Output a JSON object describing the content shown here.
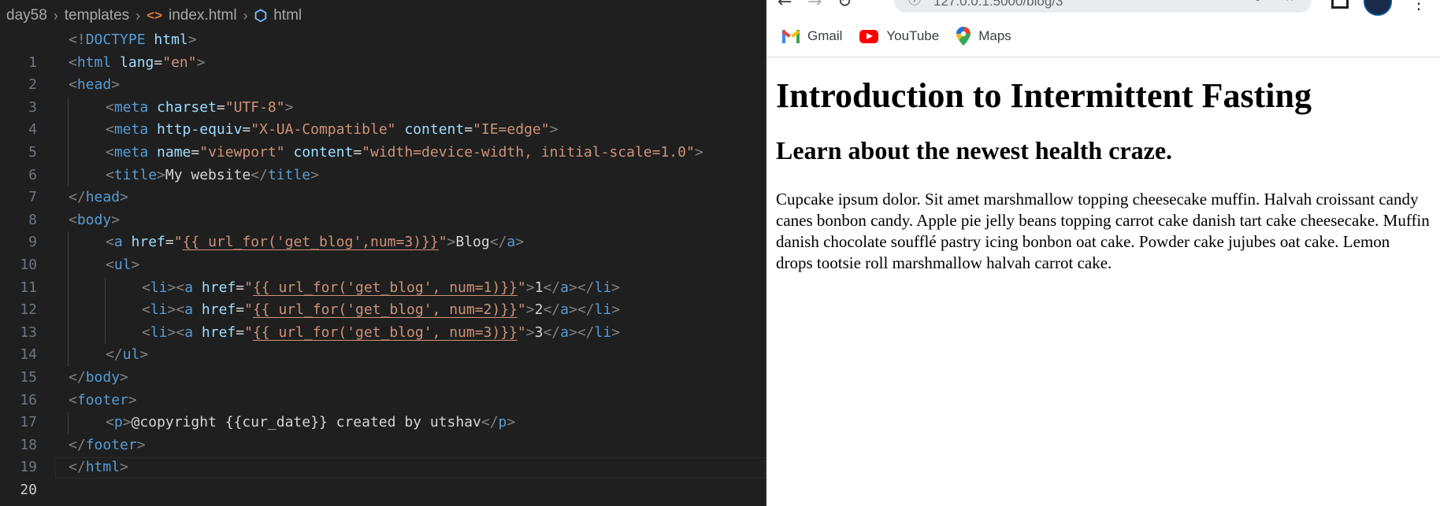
{
  "breadcrumb": [
    "day58",
    "templates",
    "index.html",
    "html"
  ],
  "code": {
    "line_numbers": [
      "1",
      "2",
      "3",
      "4",
      "5",
      "6",
      "7",
      "8",
      "9",
      "10",
      "11",
      "12",
      "13",
      "14",
      "15",
      "16",
      "17",
      "18",
      "19",
      "20"
    ],
    "l1": {
      "open": "<!",
      "kw": "DOCTYPE",
      "sp": " ",
      "name": "html",
      "close": ">"
    },
    "l2": {
      "lt": "<",
      "tag": "html",
      "sp": " ",
      "attr": "lang",
      "eq": "=",
      "val": "\"en\"",
      "gt": ">"
    },
    "l3": {
      "lt": "<",
      "tag": "head",
      "gt": ">"
    },
    "l4": {
      "lt": "<",
      "tag": "meta",
      "sp": " ",
      "attr": "charset",
      "eq": "=",
      "val": "\"UTF-8\"",
      "gt": ">"
    },
    "l5": {
      "lt": "<",
      "tag": "meta",
      "sp": " ",
      "attr1": "http-equiv",
      "eq": "=",
      "val1": "\"X-UA-Compatible\"",
      "sp2": " ",
      "attr2": "content",
      "val2": "\"IE=edge\"",
      "gt": ">"
    },
    "l6": {
      "lt": "<",
      "tag": "meta",
      "sp": " ",
      "attr1": "name",
      "eq": "=",
      "val1": "\"viewport\"",
      "sp2": " ",
      "attr2": "content",
      "val2": "\"width=device-width, initial-scale=1.0\"",
      "gt": ">"
    },
    "l7": {
      "lt": "<",
      "tag": "title",
      "gt": ">",
      "text": "My website",
      "ltc": "</",
      "tag2": "title",
      "gt2": ">"
    },
    "l8": {
      "ltc": "</",
      "tag": "head",
      "gt": ">"
    },
    "l9": {
      "lt": "<",
      "tag": "body",
      "gt": ">"
    },
    "l10": {
      "lt": "<",
      "tag": "a",
      "sp": " ",
      "attr": "href",
      "eq": "=",
      "q": "\"",
      "tmpl": "{{ url_for('get_blog',num=3)}}",
      "gt": ">",
      "text": "Blog",
      "ltc": "</",
      "tag2": "a",
      "gt2": ">"
    },
    "l11": {
      "lt": "<",
      "tag": "ul",
      "gt": ">"
    },
    "l12": {
      "tmpl": "{{ url_for('get_blog', num=1)}}",
      "text": "1"
    },
    "l13": {
      "tmpl": "{{ url_for('get_blog', num=2)}}",
      "text": "2"
    },
    "l14": {
      "tmpl": "{{ url_for('get_blog', num=3)}}",
      "text": "3"
    },
    "l15": {
      "ltc": "</",
      "tag": "ul",
      "gt": ">"
    },
    "l16": {
      "ltc": "</",
      "tag": "body",
      "gt": ">"
    },
    "l17": {
      "lt": "<",
      "tag": "footer",
      "gt": ">"
    },
    "l18": {
      "lt": "<",
      "tag": "p",
      "gt": ">",
      "text": "@copyright {{cur_date}} created by utshav",
      "ltc": "</",
      "tag2": "p",
      "gt2": ">"
    },
    "l19": {
      "ltc": "</",
      "tag": "footer",
      "gt": ">"
    },
    "l20": {
      "ltc": "</",
      "tag": "html",
      "gt": ">"
    },
    "li": {
      "lt": "<",
      "li": "li",
      "gt": ">",
      "a": "a",
      "sp": " ",
      "href": "href",
      "eq": "=",
      "q": "\"",
      "ltc": "</"
    }
  },
  "browser": {
    "url": "127.0.0.1:5000/blog/3",
    "bookmarks": [
      {
        "label": "Gmail",
        "icon": "gmail-icon"
      },
      {
        "label": "YouTube",
        "icon": "youtube-icon"
      },
      {
        "label": "Maps",
        "icon": "maps-icon"
      }
    ],
    "page": {
      "h1": "Introduction to Intermittent Fasting",
      "h2": "Learn about the newest health craze.",
      "p": "Cupcake ipsum dolor. Sit amet marshmallow topping cheesecake muffin. Halvah croissant candy canes bonbon candy. Apple pie jelly beans topping carrot cake danish tart cake cheesecake. Muffin danish chocolate soufflé pastry icing bonbon oat cake. Powder cake jujubes oat cake. Lemon drops tootsie roll marshmallow halvah carrot cake."
    }
  }
}
